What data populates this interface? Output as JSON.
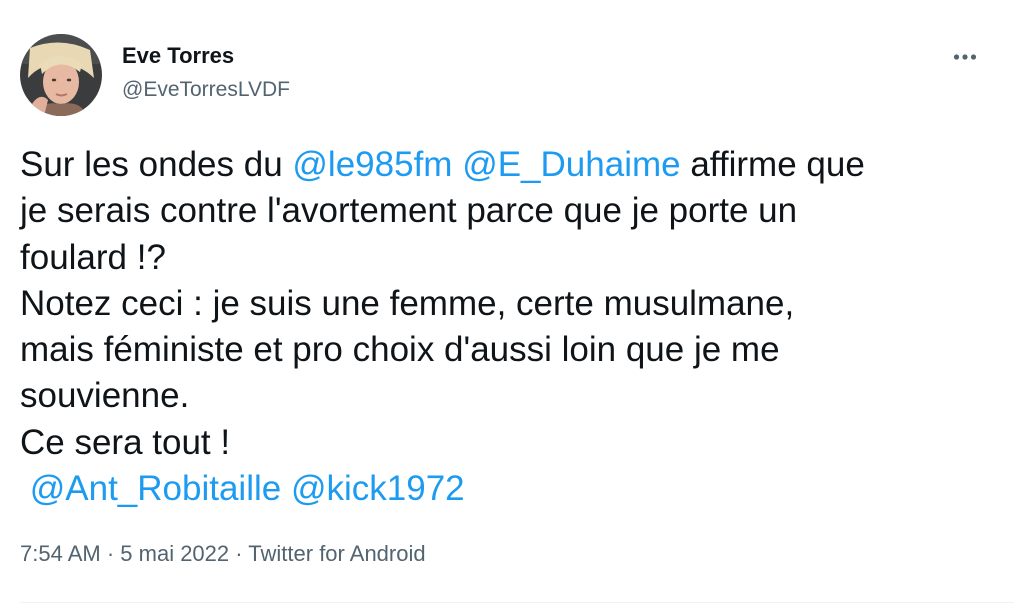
{
  "author": {
    "display_name": "Eve Torres",
    "handle": "@EveTorresLVDF",
    "avatar_icon": "profile-photo"
  },
  "menu": {
    "icon": "more-horizontal-icon"
  },
  "tweet": {
    "line1_before": "Sur les ondes du ",
    "mention_1": "@le985fm",
    "space_1": " ",
    "mention_2": "@E_Duhaime",
    "line1_after": " affirme que",
    "line2": "je serais contre l'avortement parce que je porte un",
    "line3": "foulard !?",
    "line4": "Notez ceci : je suis une femme, certe musulmane,",
    "line5": "mais féministe et pro choix d'aussi loin que je me",
    "line6": "souvienne.",
    "line7": "Ce sera tout !",
    "line8_lead": " ",
    "mention_3": "@Ant_Robitaille",
    "space_2": " ",
    "mention_4": "@kick1972"
  },
  "meta": {
    "time": "7:54 AM",
    "sep1": " · ",
    "date": "5 mai 2022",
    "sep2": " · ",
    "source": "Twitter for Android"
  },
  "colors": {
    "text": "#0f1419",
    "secondary": "#536471",
    "link": "#1d9bf0"
  }
}
